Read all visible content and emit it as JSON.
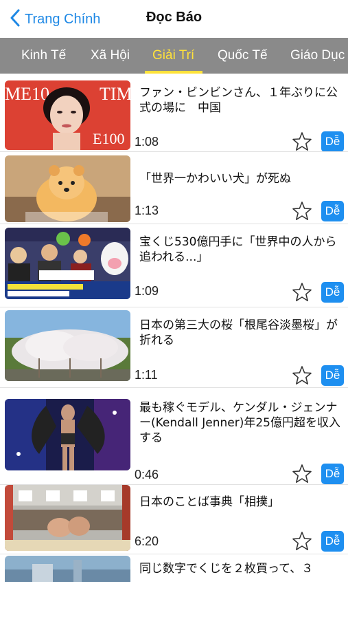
{
  "navbar": {
    "back_label": "Trang Chính",
    "title": "Đọc Báo"
  },
  "tabs": [
    {
      "label": "Kinh Tế",
      "active": false
    },
    {
      "label": "Xã Hội",
      "active": false
    },
    {
      "label": "Giải Trí",
      "active": true
    },
    {
      "label": "Quốc Tế",
      "active": false
    },
    {
      "label": "Giáo Dục",
      "active": false
    }
  ],
  "colors": {
    "accent": "#1e88e5",
    "tab_bar": "#8a8a8a",
    "tab_active": "#ffe23a",
    "badge": "#1e8ff0"
  },
  "articles": [
    {
      "title": "ファン・ビンビンさん、１年ぶりに公式の場に　中国",
      "duration": "1:08",
      "level": "Dễ",
      "thumb": "woman-portrait-red"
    },
    {
      "title": "「世界一かわいい犬」が死ぬ",
      "duration": "1:13",
      "level": "Dễ",
      "thumb": "pomeranian-dog"
    },
    {
      "title": "宝くじ530億円手に「世界中の人から追われる...」",
      "duration": "1:09",
      "level": "Dễ",
      "thumb": "lottery-news-broadcast"
    },
    {
      "title": "日本の第三大の桜「根尾谷淡墨桜」が折れる",
      "duration": "1:11",
      "level": "Dễ",
      "thumb": "cherry-tree"
    },
    {
      "title": "最も稼ぐモデル、ケンダル・ジェンナー(Kendall Jenner)年25億円超を収入する",
      "duration": "0:46",
      "level": "Dễ",
      "thumb": "runway-model"
    },
    {
      "title": "日本のことば事典「相撲」",
      "duration": "6:20",
      "level": "Dễ",
      "thumb": "sumo-wrestlers"
    },
    {
      "title": "同じ数字でくじを２枚買って、３",
      "duration": "",
      "level": "",
      "thumb": "sky-scene"
    }
  ]
}
